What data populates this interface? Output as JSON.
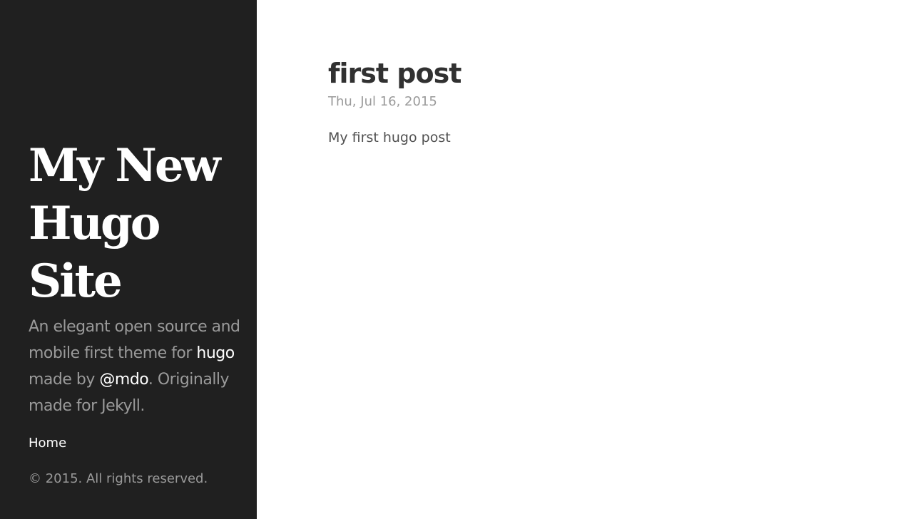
{
  "sidebar": {
    "site_title": "My New Hugo Site",
    "tagline": {
      "part1": "An elegant open source and mobile first theme for ",
      "hugo_link": "hugo",
      "part2": " made by ",
      "mdo_link": "@mdo",
      "part3": ". Originally made for Jekyll."
    },
    "nav": {
      "home": "Home"
    },
    "copyright": "© 2015. All rights reserved."
  },
  "post": {
    "title": "first post",
    "date": "Thu, Jul 16, 2015",
    "body": "My first hugo post"
  },
  "colors": {
    "sidebar_bg": "#202020",
    "sidebar_text": "#ffffff",
    "sidebar_muted": "#9a9a9a",
    "heading": "#313131",
    "body_text": "#515151"
  }
}
